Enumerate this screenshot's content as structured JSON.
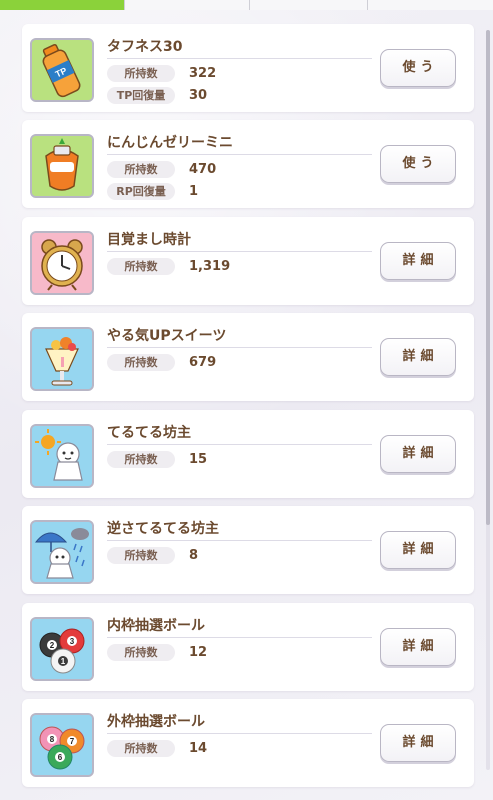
{
  "tabs": [
    "",
    "",
    "",
    ""
  ],
  "items": [
    {
      "name": "タフネス30",
      "stats": [
        {
          "label": "所持数",
          "value": "322"
        },
        {
          "label": "TP回復量",
          "value": "30"
        }
      ],
      "button": "使う",
      "icon": "tp-drink-icon"
    },
    {
      "name": "にんじんゼリーミニ",
      "stats": [
        {
          "label": "所持数",
          "value": "470"
        },
        {
          "label": "RP回復量",
          "value": "1"
        }
      ],
      "button": "使う",
      "icon": "carrot-jelly-icon"
    },
    {
      "name": "目覚まし時計",
      "stats": [
        {
          "label": "所持数",
          "value": "1,319"
        }
      ],
      "button": "詳細",
      "icon": "alarm-clock-icon"
    },
    {
      "name": "やる気UPスイーツ",
      "stats": [
        {
          "label": "所持数",
          "value": "679"
        }
      ],
      "button": "詳細",
      "icon": "parfait-icon"
    },
    {
      "name": "てるてる坊主",
      "stats": [
        {
          "label": "所持数",
          "value": "15"
        }
      ],
      "button": "詳細",
      "icon": "teru-teru-bozu-icon"
    },
    {
      "name": "逆さてるてる坊主",
      "stats": [
        {
          "label": "所持数",
          "value": "8"
        }
      ],
      "button": "詳細",
      "icon": "upside-down-teru-teru-bozu-icon"
    },
    {
      "name": "内枠抽選ボール",
      "stats": [
        {
          "label": "所持数",
          "value": "12"
        }
      ],
      "button": "詳細",
      "icon": "inner-lottery-balls-icon"
    },
    {
      "name": "外枠抽選ボール",
      "stats": [
        {
          "label": "所持数",
          "value": "14"
        }
      ],
      "button": "詳細",
      "icon": "outer-lottery-balls-icon"
    }
  ]
}
